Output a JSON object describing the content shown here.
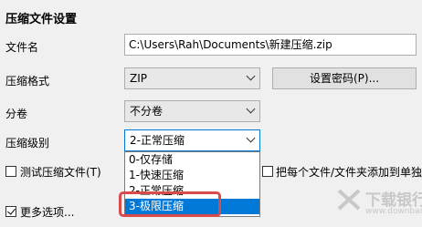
{
  "section_title": "压缩文件设置",
  "filename": {
    "label": "文件名",
    "value": "C:\\Users\\Rah\\Documents\\新建压缩.zip"
  },
  "format": {
    "label": "压缩格式",
    "value": "ZIP",
    "password_button": "设置密码(P)..."
  },
  "split": {
    "label": "分卷",
    "value": "不分卷"
  },
  "level": {
    "label": "压缩级别",
    "value": "2-正常压缩",
    "options": [
      "0-仅存储",
      "1-快速压缩",
      "2-正常压缩",
      "3-极限压缩"
    ]
  },
  "test_checkbox": {
    "label": "测试压缩文件(T)",
    "checked": false
  },
  "add_each_checkbox": {
    "label": "把每个文件/文件夹添加到单独的",
    "checked": false
  },
  "more_options": {
    "label": "更多选项...",
    "checked": true
  },
  "watermark": {
    "brand": "下载银行",
    "site": "www.downbank.cn"
  },
  "colors": {
    "selection": "#0078d7",
    "highlight": "#d94a4a"
  }
}
